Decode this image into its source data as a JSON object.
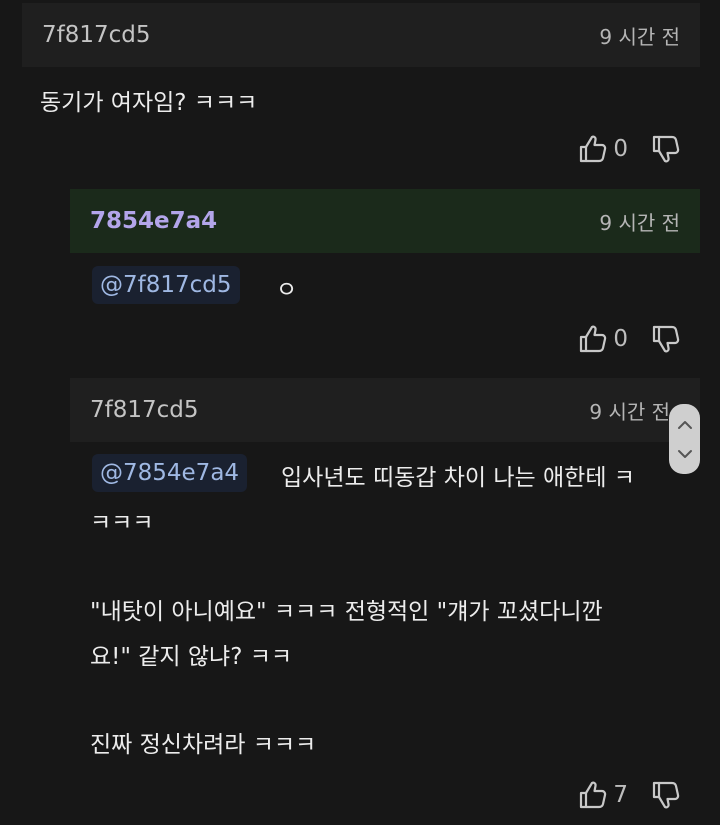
{
  "comments": [
    {
      "username": "7f817cd5",
      "time": "9 시간 전",
      "text": "동기가 여자임? ㅋㅋㅋ",
      "likes": "0"
    },
    {
      "username": "7854e7a4",
      "time": "9 시간 전",
      "mention": "@7f817cd5",
      "text": "ㅇ",
      "likes": "0"
    },
    {
      "username": "7f817cd5",
      "time": "9 시간 전",
      "mention": "@7854e7a4",
      "lines": [
        "입사년도 띠동갑 차이 나는 애한테 ㅋ",
        "ㅋㅋㅋ",
        "\"내탓이 아니예요\" ㅋㅋㅋ 전형적인 \"걔가 꼬셨다니깐",
        "요!\" 같지 않냐? ㅋㅋ",
        "진짜 정신차려라 ㅋㅋㅋ"
      ],
      "likes": "7"
    }
  ],
  "icons": {
    "like": "thumbs-up-icon",
    "dislike": "thumbs-down-icon",
    "scroll_up": "chevron-up-icon",
    "scroll_down": "chevron-down-icon"
  },
  "colors": {
    "background": "#171717",
    "header": "#1f1f1f",
    "reply_header": "#1b2a1b",
    "username_highlight": "#b3a5ea",
    "mention_bg": "#1a2130",
    "mention_text": "#9fb8e3"
  }
}
